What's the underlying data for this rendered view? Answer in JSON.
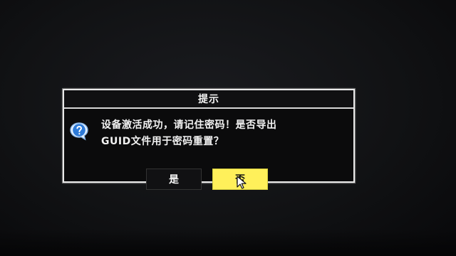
{
  "dialog": {
    "title": "提示",
    "message_line1": "设备激活成功，请记住密码！是否导出",
    "message_line2": "GUID文件用于密码重置？",
    "yes_label": "是",
    "no_label": "否"
  },
  "icons": {
    "help": "help-icon",
    "cursor": "cursor-icon"
  },
  "colors": {
    "dialog_border": "#e9e9e9",
    "selected_button": "#fff05a",
    "background": "#111214"
  }
}
